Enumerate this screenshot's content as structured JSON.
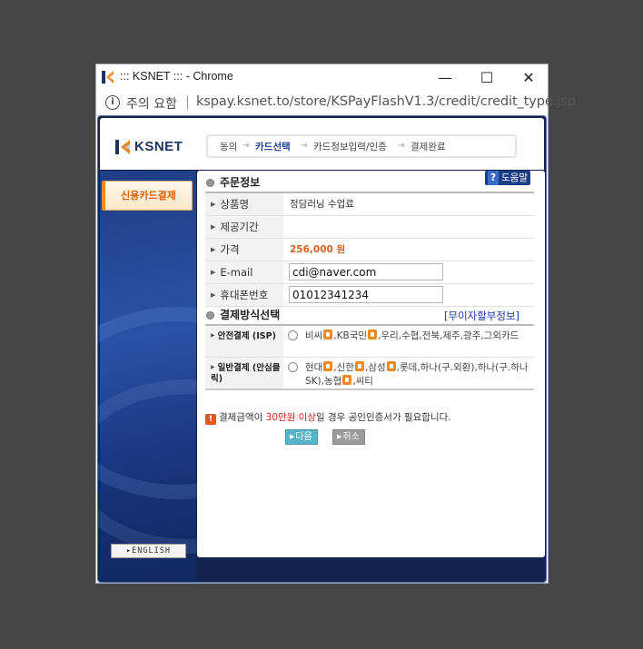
{
  "window": {
    "title": "::: KSNET ::: - Chrome",
    "minimize_glyph": "—",
    "maximize_glyph": "☐",
    "close_glyph": "✕"
  },
  "addressbar": {
    "info_icon": "info-icon",
    "info_glyph": "i",
    "warning": "주의 요함",
    "url": "kspay.ksnet.to/store/KSPayFlashV1.3/credit/credit_type.jsp"
  },
  "header": {
    "logo_text": "KSNET",
    "steps": [
      "동의",
      "카드선택",
      "카드정보입력/인증",
      "결제완료"
    ],
    "active_step": "카드선택"
  },
  "sidebar": {
    "tab_label": "신용카드결제",
    "english_label": "▸ENGLISH"
  },
  "order": {
    "section_title": "주문정보",
    "help_glyph": "?",
    "help_label": "도움말",
    "rows": [
      {
        "label": "상품명",
        "value": "정담러닝 수업료"
      },
      {
        "label": "제공기간",
        "value": ""
      },
      {
        "label": "가격",
        "value": "256,000 원"
      },
      {
        "label": "E-mail",
        "value": "cdi@naver.com"
      },
      {
        "label": "휴대폰번호",
        "value": "01012341234"
      }
    ]
  },
  "payment": {
    "section_title": "결제방식선택",
    "interest_free_link": "[무이자할부정보]",
    "options": [
      {
        "label": "안전결제 (ISP)",
        "cards": [
          "비씨",
          ",KB국민",
          ",우리,수협,전북,제주,광주,그외카드"
        ]
      },
      {
        "label": "일반결제 (안심클릭)",
        "cards": [
          "현대",
          ",신한",
          ",삼성",
          ",롯데,하나(구.외환),하나(구.하나SK),농협",
          ",씨티"
        ]
      }
    ]
  },
  "notice": {
    "icon_glyph": "!",
    "prefix": "결제금액이 ",
    "highlight": "30만원 이상",
    "suffix": "일 경우 공인인증서가 필요합니다."
  },
  "buttons": {
    "next_label": "다음",
    "cancel_label": "취소"
  },
  "colors": {
    "accent_orange": "#d95f0b",
    "nav_blue": "#1b3f86",
    "price": "#d9611b",
    "notice_highlight": "#d31f1f"
  }
}
